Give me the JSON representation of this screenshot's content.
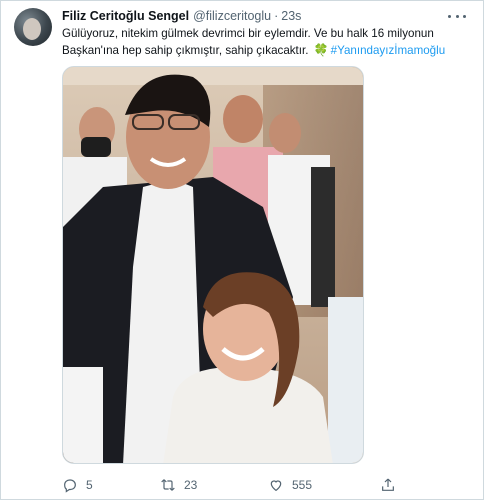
{
  "tweet": {
    "display_name": "Filiz Ceritoğlu Sengel",
    "handle": "@filizceritoglu",
    "separator": "·",
    "time": "23s",
    "text_line1": "Gülüyoruz, nitekim gülmek devrimci bir eylemdir. Ve bu halk 16 milyonun",
    "text_line2": "Başkan'ına hep sahip çıkmıştır, sahip çıkacaktır.",
    "emoji": "🍀",
    "hashtag": "#Yanındayızİmamoğlu",
    "replies": "5",
    "retweets": "23",
    "likes": "555"
  },
  "icons": {
    "more": "more-icon",
    "reply": "reply-icon",
    "retweet": "retweet-icon",
    "like": "heart-icon",
    "share": "share-icon"
  },
  "colors": {
    "link": "#1d9bf0",
    "muted": "#536471",
    "text": "#0f1419",
    "border": "#cfd9de"
  }
}
